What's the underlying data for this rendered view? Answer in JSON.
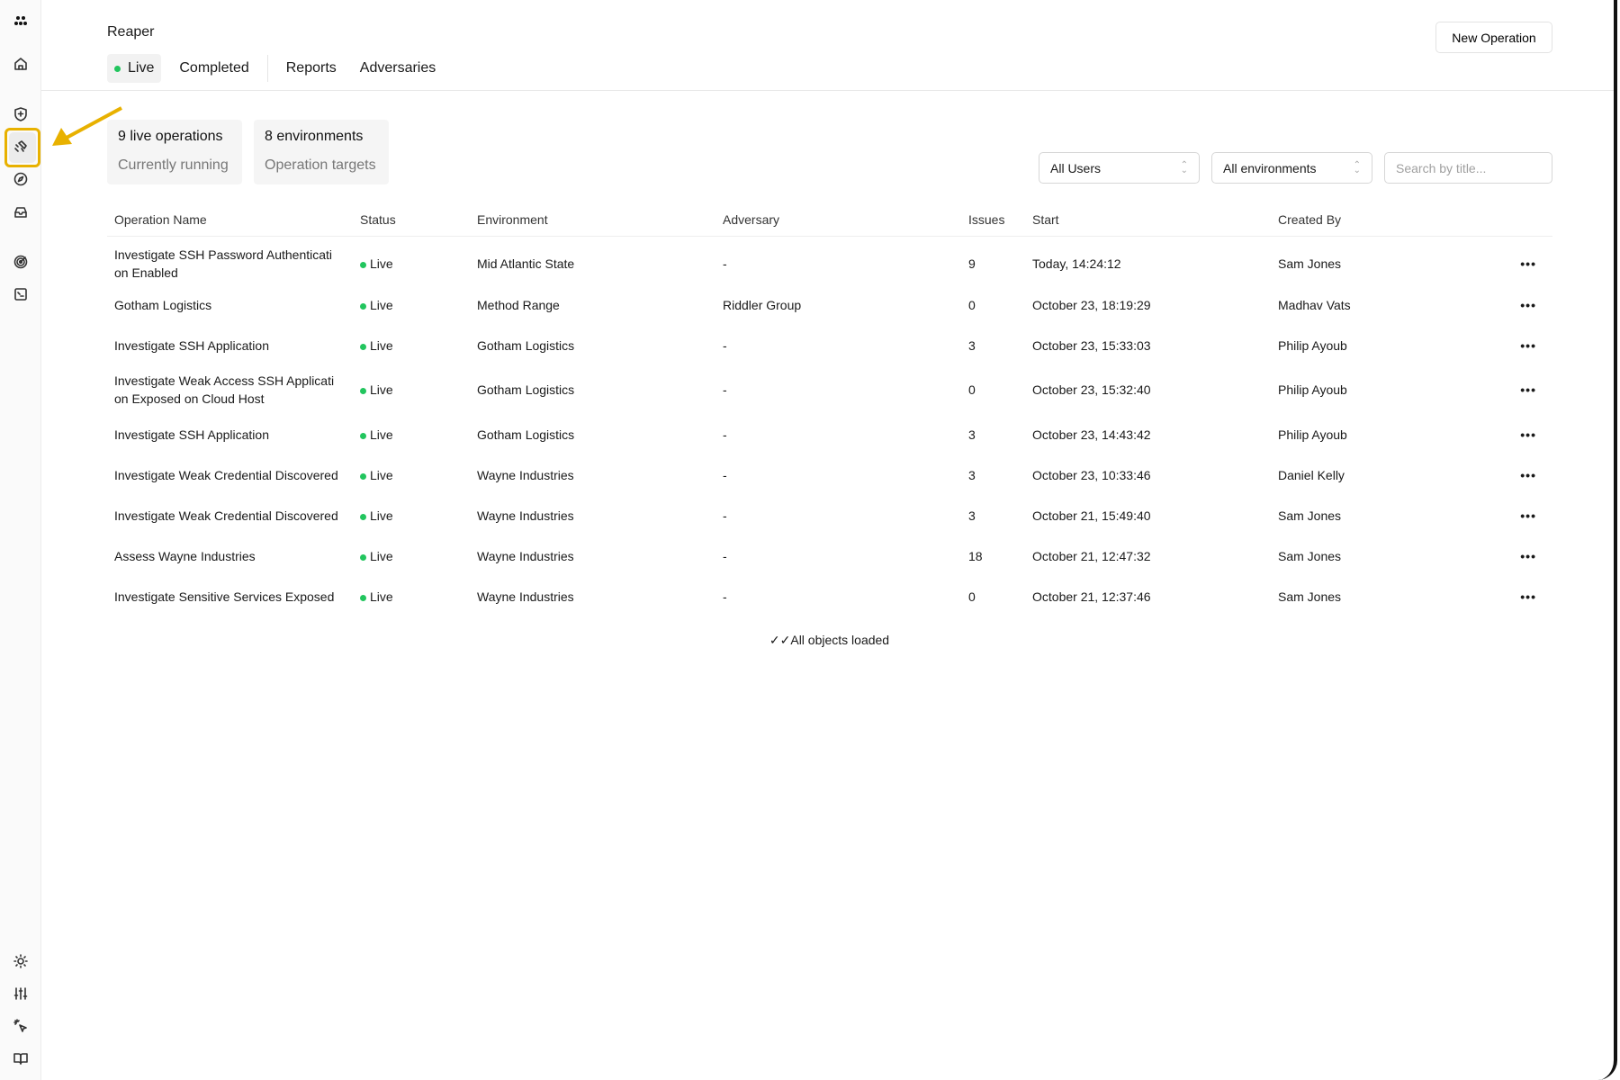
{
  "sidebar": {
    "icons": [
      "logo-icon",
      "home-icon",
      "shield-icon",
      "operations-icon",
      "compass-icon",
      "inbox-icon",
      "radar-icon",
      "terminal-icon",
      "sun-icon",
      "sliders-icon",
      "cursor-click-icon",
      "book-icon"
    ],
    "active": "operations-icon",
    "highlight_color": "#e8b100"
  },
  "header": {
    "title": "Reaper",
    "new_operation": "New Operation",
    "tabs": [
      {
        "label": "Live",
        "active": true
      },
      {
        "label": "Completed"
      },
      {
        "label": "Reports"
      },
      {
        "label": "Adversaries"
      }
    ]
  },
  "stats": [
    {
      "value": "9 live operations",
      "caption": "Currently running"
    },
    {
      "value": "8 environments",
      "caption": "Operation targets"
    }
  ],
  "filters": {
    "users": "All Users",
    "environments": "All environments",
    "search_placeholder": "Search by title..."
  },
  "table": {
    "columns": [
      "Operation Name",
      "Status",
      "Environment",
      "Adversary",
      "Issues",
      "Start",
      "Created By"
    ],
    "rows": [
      {
        "name": "Investigate SSH Password Authenticati on Enabled",
        "status": "Live",
        "environment": "Mid Atlantic State",
        "adversary": "-",
        "issues": "9",
        "start": "Today, 14:24:12",
        "created_by": "Sam Jones"
      },
      {
        "name": "Gotham Logistics",
        "status": "Live",
        "environment": "Method Range",
        "adversary": "Riddler Group",
        "issues": "0",
        "start": "October 23, 18:19:29",
        "created_by": "Madhav Vats"
      },
      {
        "name": "Investigate SSH Application",
        "status": "Live",
        "environment": "Gotham Logistics",
        "adversary": "-",
        "issues": "3",
        "start": "October 23, 15:33:03",
        "created_by": "Philip Ayoub"
      },
      {
        "name": "Investigate Weak Access SSH Applicati on Exposed on Cloud Host",
        "status": "Live",
        "environment": "Gotham Logistics",
        "adversary": "-",
        "issues": "0",
        "start": "October 23, 15:32:40",
        "created_by": "Philip Ayoub"
      },
      {
        "name": "Investigate SSH Application",
        "status": "Live",
        "environment": "Gotham Logistics",
        "adversary": "-",
        "issues": "3",
        "start": "October 23, 14:43:42",
        "created_by": "Philip Ayoub"
      },
      {
        "name": "Investigate Weak Credential Discovered",
        "status": "Live",
        "environment": "Wayne Industries",
        "adversary": "-",
        "issues": "3",
        "start": "October 23, 10:33:46",
        "created_by": "Daniel Kelly"
      },
      {
        "name": "Investigate Weak Credential Discovered",
        "status": "Live",
        "environment": "Wayne Industries",
        "adversary": "-",
        "issues": "3",
        "start": "October 21, 15:49:40",
        "created_by": "Sam Jones"
      },
      {
        "name": "Assess Wayne Industries",
        "status": "Live",
        "environment": "Wayne Industries",
        "adversary": "-",
        "issues": "18",
        "start": "October 21, 12:47:32",
        "created_by": "Sam Jones"
      },
      {
        "name": "Investigate Sensitive Services Exposed",
        "status": "Live",
        "environment": "Wayne Industries",
        "adversary": "-",
        "issues": "0",
        "start": "October 21, 12:37:46",
        "created_by": "Sam Jones"
      }
    ],
    "more_label": "•••",
    "footer": "All objects loaded"
  },
  "colors": {
    "live": "#22c55e",
    "annotation": "#e8b100"
  }
}
